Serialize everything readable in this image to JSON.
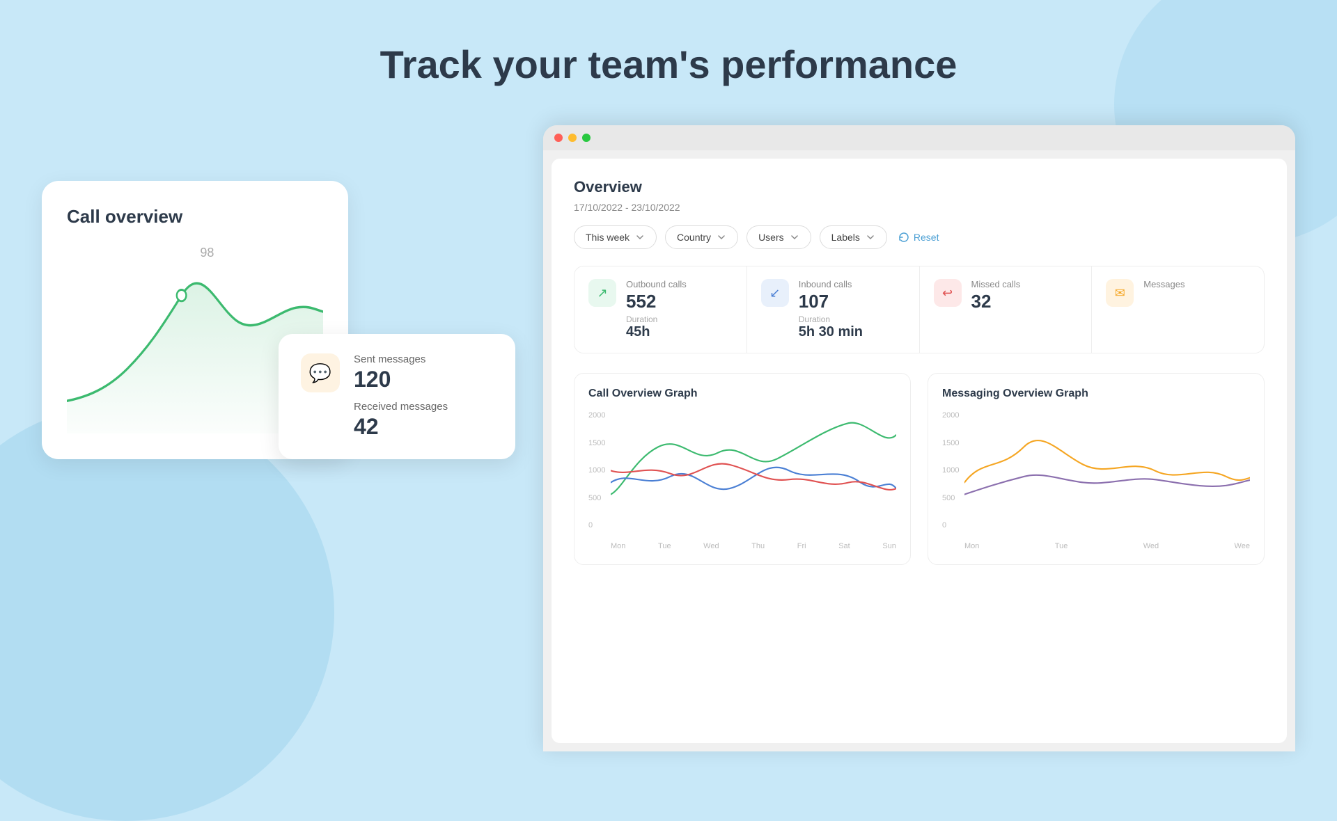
{
  "page": {
    "heading": "Track your team's performance"
  },
  "call_overview_card": {
    "title": "Call overview",
    "peak_value": "98"
  },
  "messages_card": {
    "sent_label": "Sent messages",
    "sent_value": "120",
    "received_label": "Received messages",
    "received_value": "42"
  },
  "dashboard": {
    "title": "Overview",
    "date_range": "17/10/2022 - 23/10/2022",
    "filters": {
      "time": "This week",
      "country": "Country",
      "users": "Users",
      "labels": "Labels",
      "reset": "Reset"
    },
    "metrics": [
      {
        "name": "Outbound calls",
        "value": "552",
        "sub_label": "Duration",
        "sub_value": "45h",
        "icon_type": "green",
        "icon": "↗"
      },
      {
        "name": "Inbound calls",
        "value": "107",
        "sub_label": "Duration",
        "sub_value": "5h 30 min",
        "icon_type": "blue",
        "icon": "↙"
      },
      {
        "name": "Missed calls",
        "value": "32",
        "sub_label": "",
        "sub_value": "",
        "icon_type": "red",
        "icon": "↩"
      },
      {
        "name": "Messages",
        "value": "",
        "sub_label": "",
        "sub_value": "",
        "icon_type": "orange",
        "icon": "✉"
      }
    ],
    "call_graph": {
      "title": "Call Overview Graph",
      "y_labels": [
        "2000",
        "1500",
        "1000",
        "500",
        "0"
      ],
      "x_labels": [
        "Mon",
        "Tue",
        "Wed",
        "Thu",
        "Fri",
        "Sat",
        "Sun"
      ]
    },
    "messaging_graph": {
      "title": "Messaging Overview Graph",
      "y_labels": [
        "2000",
        "1500",
        "1000",
        "500",
        "0"
      ],
      "x_labels": [
        "Mon",
        "Tue",
        "Wed",
        "Wee"
      ]
    }
  }
}
